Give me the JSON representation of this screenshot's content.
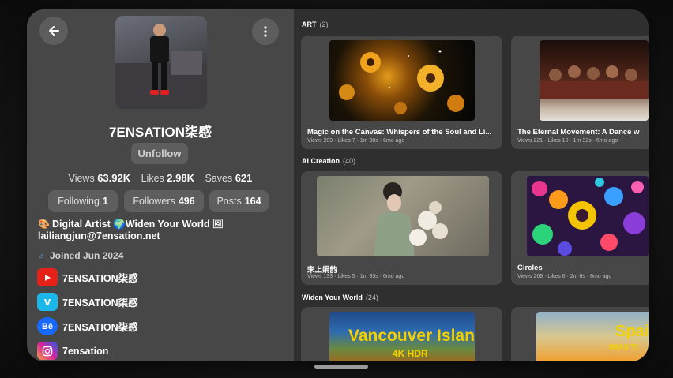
{
  "profile": {
    "name": "7ENSATION柒感",
    "unfollow_label": "Unfollow",
    "stats": [
      {
        "label": "Views",
        "value": "63.92K"
      },
      {
        "label": "Likes",
        "value": "2.98K"
      },
      {
        "label": "Saves",
        "value": "621"
      }
    ],
    "following": {
      "label": "Following",
      "value": "1"
    },
    "followers": {
      "label": "Followers",
      "value": "496"
    },
    "posts": {
      "label": "Posts",
      "value": "164"
    },
    "bio_line1": "Digital Artist 🌍Widen Your World",
    "bio_line2": "lailiangjun@7ensation.net",
    "joined": "Joined Jun 2024",
    "socials": [
      {
        "platform": "youtube-icon",
        "name": "7ENSATION柒感",
        "color": "#e62117"
      },
      {
        "platform": "vimeo-icon",
        "name": "7ENSATION柒感",
        "color": "#1ab7ea"
      },
      {
        "platform": "behance-icon",
        "name": "7ENSATION柒感",
        "color": "#1769ff"
      },
      {
        "platform": "instagram-icon",
        "name": "7ensation",
        "color": "#d6249f"
      }
    ]
  },
  "sections": [
    {
      "title": "ART",
      "count": "(2)",
      "cards": [
        {
          "title": "Magic on the Canvas: Whispers of the Soul and Li...",
          "meta": "Views 209 · Likes 7 · 1m 38s · 6mo ago"
        },
        {
          "title": "The Eternal Movement: A Dance w",
          "meta": "Views 221 · Likes 10 · 1m 32s · 6mo ago"
        }
      ]
    },
    {
      "title": "AI Creation",
      "count": "(40)",
      "cards": [
        {
          "title": "宋上娟韵",
          "meta": "Views 133 · Likes 5 · 1m 35s · 6mo ago"
        },
        {
          "title": "Circles",
          "meta": "Views 269 · Likes 6 · 2m 6s · 6mo ago"
        }
      ]
    },
    {
      "title": "Widen Your World",
      "count": "(24)",
      "cards": [
        {
          "title": "",
          "meta": "",
          "thumb_text": "Vancouver Island",
          "thumb_sub": "4K HDR"
        },
        {
          "title": "",
          "meta": "",
          "thumb_text": "Spain",
          "thumb_sub": "IMAX Ti"
        }
      ]
    }
  ],
  "colors": {
    "accent_yellow": "#f5d000",
    "panel_left": "#474747",
    "panel_right": "#2f2f2f"
  }
}
